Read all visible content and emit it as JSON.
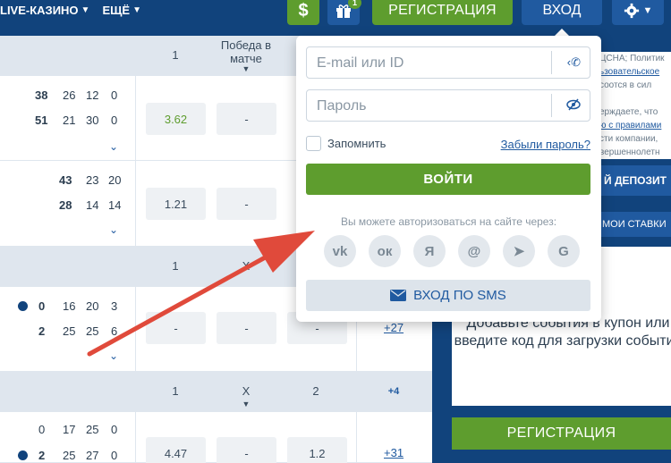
{
  "topnav": {
    "items": [
      {
        "label": "LIVE-КАЗИНО"
      },
      {
        "label": "ЕЩЁ"
      }
    ],
    "dollar_label": "$",
    "gift_badge": "1",
    "register_label": "РЕГИСТРАЦИЯ",
    "login_label": "ВХОД"
  },
  "table": {
    "header1": {
      "col1": "1",
      "col2": "Победа в матче"
    },
    "header2": {
      "col1": "1",
      "col2": "X",
      "col3": "2"
    },
    "header3": {
      "col1": "1",
      "col2": "X",
      "col3": "2",
      "more": "+4"
    },
    "rows": [
      {
        "t1": {
          "main": "38",
          "s": [
            "26",
            "12",
            "0"
          ]
        },
        "t2": {
          "main": "51",
          "s": [
            "21",
            "30",
            "0"
          ]
        },
        "odd1": "3.62",
        "odd2": "-"
      },
      {
        "t1": {
          "main": "43",
          "s": [
            "23",
            "20"
          ]
        },
        "t2": {
          "main": "28",
          "s": [
            "14",
            "14"
          ]
        },
        "odd1": "1.21",
        "odd2": "-"
      },
      {
        "t1": {
          "main": "0",
          "s": [
            "16",
            "20",
            "3"
          ]
        },
        "t2": {
          "main": "2",
          "s": [
            "25",
            "25",
            "6"
          ]
        },
        "odd1": "-",
        "odd2": "-",
        "odd3": "-",
        "more": "+27"
      },
      {
        "t1": {
          "main": "0",
          "s": [
            "17",
            "25",
            "0"
          ]
        },
        "t2": {
          "main": "2",
          "s": [
            "25",
            "27",
            "0"
          ]
        },
        "odd1": "4.47",
        "odd2": "-",
        "odd3": "1.2",
        "more": "+31"
      }
    ]
  },
  "right_panel": {
    "terms_lines": [
      "ЦСНА; Политик",
      "ьзовательское",
      "соотся в сил",
      "",
      "ерждаете, что",
      "ю с правилами",
      "сти компании,",
      "вершеннолетн"
    ],
    "deposit_label": "Й ДЕПОЗИТ",
    "my_bets_label": "МОИ СТАВКИ",
    "coupon_text": "Добавьте события в купон или введите код для загрузки событий",
    "register_label": "РЕГИСТРАЦИЯ"
  },
  "login_popup": {
    "email_placeholder": "E-mail или ID",
    "password_placeholder": "Пароль",
    "remember_label": "Запомнить",
    "forgot_label": "Забыли пароль?",
    "login_button": "ВОЙТИ",
    "via_text": "Вы можете авторизоваться на сайте через:",
    "socials": [
      {
        "name": "vk-icon",
        "glyph": "vk"
      },
      {
        "name": "odnoklassniki-icon",
        "glyph": "ок"
      },
      {
        "name": "yandex-icon",
        "glyph": "Я"
      },
      {
        "name": "mail-ru-icon",
        "glyph": "@"
      },
      {
        "name": "telegram-icon",
        "glyph": "➤"
      },
      {
        "name": "google-icon",
        "glyph": "G"
      }
    ],
    "sms_button": "ВХОД ПО SMS"
  },
  "colors": {
    "header_blue": "#11437c",
    "button_blue": "#205aa0",
    "green": "#5e9d2e",
    "arrow_red": "#e04a3b"
  }
}
